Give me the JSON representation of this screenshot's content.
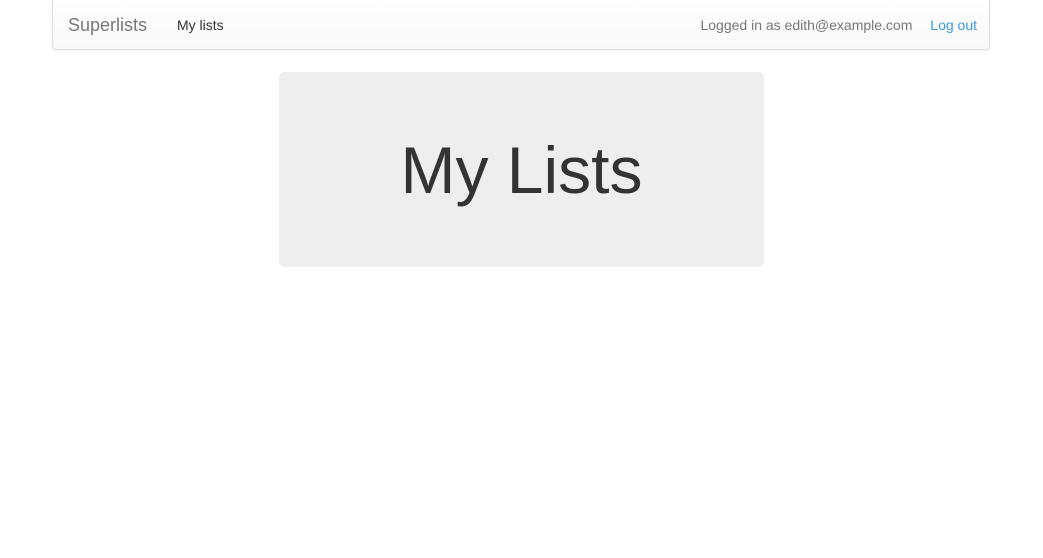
{
  "navbar": {
    "brand": "Superlists",
    "my_lists_link": "My lists",
    "logged_in_text": "Logged in as edith@example.com",
    "logout_link": "Log out"
  },
  "main": {
    "title": "My Lists"
  },
  "colors": {
    "link": "#3a9ad9",
    "jumbotron_bg": "#eeeeee"
  }
}
